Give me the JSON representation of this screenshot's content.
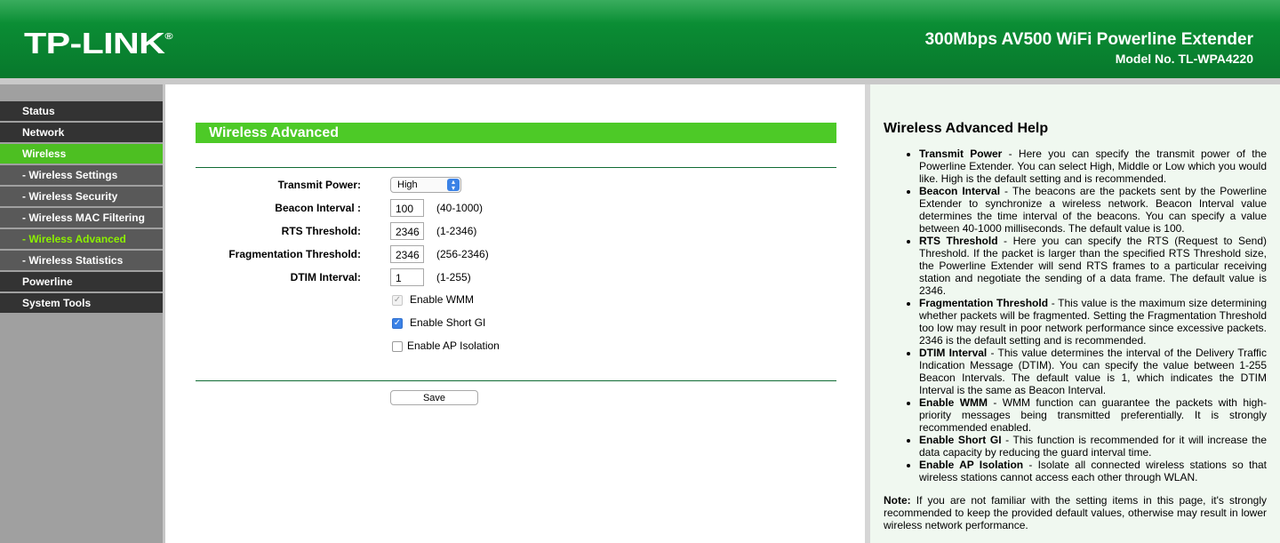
{
  "header": {
    "logo": "TP-LINK",
    "logo_mark": "®",
    "product": "300Mbps AV500 WiFi Powerline Extender",
    "model": "Model No. TL-WPA4220"
  },
  "sidebar": {
    "items": [
      {
        "label": "Status"
      },
      {
        "label": "Network"
      },
      {
        "label": "Wireless"
      },
      {
        "label": "- Wireless Settings"
      },
      {
        "label": "- Wireless Security"
      },
      {
        "label": "- Wireless MAC Filtering"
      },
      {
        "label": "- Wireless Advanced"
      },
      {
        "label": "- Wireless Statistics"
      },
      {
        "label": "Powerline"
      },
      {
        "label": "System Tools"
      }
    ]
  },
  "main": {
    "title": "Wireless Advanced",
    "transmit_power": {
      "label": "Transmit Power:",
      "value": "High"
    },
    "beacon_interval": {
      "label": "Beacon Interval :",
      "value": "100",
      "range": "(40-1000)"
    },
    "rts_threshold": {
      "label": "RTS Threshold:",
      "value": "2346",
      "range": "(1-2346)"
    },
    "frag_threshold": {
      "label": "Fragmentation Threshold:",
      "value": "2346",
      "range": "(256-2346)"
    },
    "dtim_interval": {
      "label": "DTIM Interval:",
      "value": "1",
      "range": "(1-255)"
    },
    "enable_wmm": {
      "label": "Enable WMM",
      "checked": true,
      "disabled": true
    },
    "enable_short_gi": {
      "label": "Enable Short GI",
      "checked": true
    },
    "enable_ap_isolation": {
      "label": "Enable AP Isolation",
      "checked": false
    },
    "save_label": "Save"
  },
  "help": {
    "title": "Wireless Advanced Help",
    "items": [
      {
        "term": "Transmit Power",
        "text": " - Here you can specify the transmit power of the Powerline Extender. You can select High, Middle or Low which you would like. High is the default setting and is recommended."
      },
      {
        "term": "Beacon Interval",
        "text": " - The beacons are the packets sent by the Powerline Extender to synchronize a wireless network. Beacon Interval value determines the time interval of the beacons. You can specify a value between 40-1000 milliseconds. The default value is 100."
      },
      {
        "term": "RTS Threshold",
        "text": " - Here you can specify the RTS (Request to Send) Threshold. If the packet is larger than the specified RTS Threshold size, the Powerline Extender will send RTS frames to a particular receiving station and negotiate the sending of a data frame. The default value is 2346."
      },
      {
        "term": "Fragmentation Threshold",
        "text": " - This value is the maximum size determining whether packets will be fragmented. Setting the Fragmentation Threshold too low may result in poor network performance since excessive packets. 2346 is the default setting and is recommended."
      },
      {
        "term": "DTIM Interval",
        "text": " - This value determines the interval of the Delivery Traffic Indication Message (DTIM). You can specify the value between 1-255 Beacon Intervals. The default value is 1, which indicates the DTIM Interval is the same as Beacon Interval."
      },
      {
        "term": "Enable WMM",
        "text": " - WMM function can guarantee the packets with high-priority messages being transmitted preferentially. It is strongly recommended enabled."
      },
      {
        "term": "Enable Short GI",
        "text": " - This function is recommended for it will increase the data capacity by reducing the guard interval time."
      },
      {
        "term": "Enable AP Isolation",
        "text": " - Isolate all connected wireless stations so that wireless stations cannot access each other through WLAN."
      }
    ],
    "note_label": "Note:",
    "note_text": " If you are not familiar with the setting items in this page, it's strongly recommended to keep the provided default values, otherwise may result in lower wireless network performance."
  },
  "colors": {
    "brand_green": "#0a8a33",
    "accent_green": "#4dca27",
    "menu_dark": "#333333",
    "menu_sub": "#595959",
    "selected_text": "#8cf000"
  }
}
